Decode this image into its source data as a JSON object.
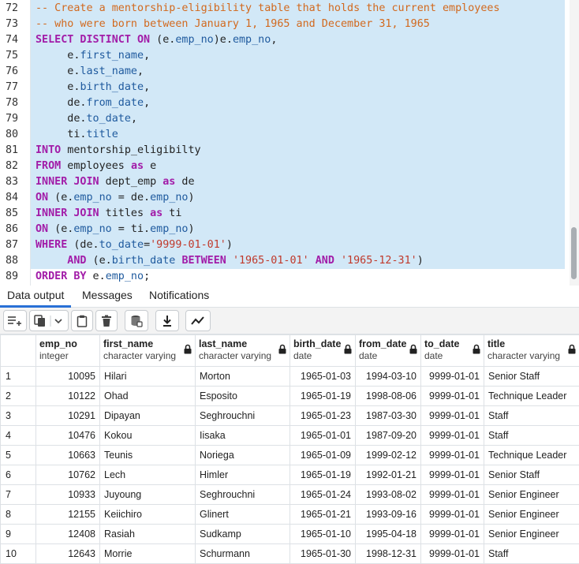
{
  "editor": {
    "line_numbers": [
      "72",
      "73",
      "74",
      "75",
      "76",
      "77",
      "78",
      "79",
      "80",
      "81",
      "82",
      "83",
      "84",
      "85",
      "86",
      "87",
      "88",
      "89"
    ],
    "lines": [
      [
        {
          "t": "-- Create a mentorship-eligibility table that holds the current employees",
          "c": "comment"
        }
      ],
      [
        {
          "t": "-- who were born between January 1, 1965 and December 31, 1965",
          "c": "comment"
        }
      ],
      [
        {
          "t": "SELECT DISTINCT ON",
          "c": "kw"
        },
        {
          "t": " (e.",
          "c": "plain"
        },
        {
          "t": "emp_no",
          "c": "id"
        },
        {
          "t": ")e.",
          "c": "plain"
        },
        {
          "t": "emp_no",
          "c": "id"
        },
        {
          "t": ",",
          "c": "plain"
        }
      ],
      [
        {
          "t": "     e.",
          "c": "plain"
        },
        {
          "t": "first_name",
          "c": "id"
        },
        {
          "t": ",",
          "c": "plain"
        }
      ],
      [
        {
          "t": "     e.",
          "c": "plain"
        },
        {
          "t": "last_name",
          "c": "id"
        },
        {
          "t": ",",
          "c": "plain"
        }
      ],
      [
        {
          "t": "     e.",
          "c": "plain"
        },
        {
          "t": "birth_date",
          "c": "id"
        },
        {
          "t": ",",
          "c": "plain"
        }
      ],
      [
        {
          "t": "     de.",
          "c": "plain"
        },
        {
          "t": "from_date",
          "c": "id"
        },
        {
          "t": ",",
          "c": "plain"
        }
      ],
      [
        {
          "t": "     de.",
          "c": "plain"
        },
        {
          "t": "to_date",
          "c": "id"
        },
        {
          "t": ",",
          "c": "plain"
        }
      ],
      [
        {
          "t": "     ti.",
          "c": "plain"
        },
        {
          "t": "title",
          "c": "id"
        }
      ],
      [
        {
          "t": "INTO",
          "c": "kw"
        },
        {
          "t": " mentorship_eligibilty",
          "c": "plain"
        }
      ],
      [
        {
          "t": "FROM",
          "c": "kw"
        },
        {
          "t": " employees ",
          "c": "plain"
        },
        {
          "t": "as",
          "c": "kw"
        },
        {
          "t": " e",
          "c": "plain"
        }
      ],
      [
        {
          "t": "INNER JOIN",
          "c": "kw"
        },
        {
          "t": " dept_emp ",
          "c": "plain"
        },
        {
          "t": "as",
          "c": "kw"
        },
        {
          "t": " de",
          "c": "plain"
        }
      ],
      [
        {
          "t": "ON",
          "c": "kw"
        },
        {
          "t": " (e.",
          "c": "plain"
        },
        {
          "t": "emp_no",
          "c": "id"
        },
        {
          "t": " = de.",
          "c": "plain"
        },
        {
          "t": "emp_no",
          "c": "id"
        },
        {
          "t": ")",
          "c": "plain"
        }
      ],
      [
        {
          "t": "INNER JOIN",
          "c": "kw"
        },
        {
          "t": " titles ",
          "c": "plain"
        },
        {
          "t": "as",
          "c": "kw"
        },
        {
          "t": " ti",
          "c": "plain"
        }
      ],
      [
        {
          "t": "ON",
          "c": "kw"
        },
        {
          "t": " (e.",
          "c": "plain"
        },
        {
          "t": "emp_no",
          "c": "id"
        },
        {
          "t": " = ti.",
          "c": "plain"
        },
        {
          "t": "emp_no",
          "c": "id"
        },
        {
          "t": ")",
          "c": "plain"
        }
      ],
      [
        {
          "t": "WHERE",
          "c": "kw"
        },
        {
          "t": " (de.",
          "c": "plain"
        },
        {
          "t": "to_date",
          "c": "id"
        },
        {
          "t": "=",
          "c": "plain"
        },
        {
          "t": "'9999-01-01'",
          "c": "str"
        },
        {
          "t": ")",
          "c": "plain"
        }
      ],
      [
        {
          "t": "     AND",
          "c": "kw"
        },
        {
          "t": " (e.",
          "c": "plain"
        },
        {
          "t": "birth_date",
          "c": "id"
        },
        {
          "t": " ",
          "c": "plain"
        },
        {
          "t": "BETWEEN",
          "c": "kw"
        },
        {
          "t": " ",
          "c": "plain"
        },
        {
          "t": "'1965-01-01'",
          "c": "str"
        },
        {
          "t": " ",
          "c": "plain"
        },
        {
          "t": "AND",
          "c": "kw"
        },
        {
          "t": " ",
          "c": "plain"
        },
        {
          "t": "'1965-12-31'",
          "c": "str"
        },
        {
          "t": ")",
          "c": "plain"
        }
      ],
      [
        {
          "t": "ORDER BY",
          "c": "kw"
        },
        {
          "t": " e.",
          "c": "plain"
        },
        {
          "t": "emp_no",
          "c": "id"
        },
        {
          "t": ";",
          "c": "plain"
        }
      ]
    ]
  },
  "tabs": [
    {
      "label": "Data output",
      "active": true
    },
    {
      "label": "Messages",
      "active": false
    },
    {
      "label": "Notifications",
      "active": false
    }
  ],
  "toolbar": {
    "buttons": [
      "add-row-icon",
      "copy-icon",
      "dropdown-icon",
      "paste-icon",
      "delete-icon",
      "save-data-icon",
      "download-icon",
      "graph-icon"
    ]
  },
  "grid": {
    "columns": [
      {
        "name": "emp_no",
        "type": "integer",
        "locked": false
      },
      {
        "name": "first_name",
        "type": "character varying",
        "locked": true
      },
      {
        "name": "last_name",
        "type": "character varying",
        "locked": true
      },
      {
        "name": "birth_date",
        "type": "date",
        "locked": true
      },
      {
        "name": "from_date",
        "type": "date",
        "locked": true
      },
      {
        "name": "to_date",
        "type": "date",
        "locked": true
      },
      {
        "name": "title",
        "type": "character varying",
        "locked": true
      }
    ],
    "rows": [
      [
        "1",
        "10095",
        "Hilari",
        "Morton",
        "1965-01-03",
        "1994-03-10",
        "9999-01-01",
        "Senior Staff"
      ],
      [
        "2",
        "10122",
        "Ohad",
        "Esposito",
        "1965-01-19",
        "1998-08-06",
        "9999-01-01",
        "Technique Leader"
      ],
      [
        "3",
        "10291",
        "Dipayan",
        "Seghrouchni",
        "1965-01-23",
        "1987-03-30",
        "9999-01-01",
        "Staff"
      ],
      [
        "4",
        "10476",
        "Kokou",
        "Iisaka",
        "1965-01-01",
        "1987-09-20",
        "9999-01-01",
        "Staff"
      ],
      [
        "5",
        "10663",
        "Teunis",
        "Noriega",
        "1965-01-09",
        "1999-02-12",
        "9999-01-01",
        "Technique Leader"
      ],
      [
        "6",
        "10762",
        "Lech",
        "Himler",
        "1965-01-19",
        "1992-01-21",
        "9999-01-01",
        "Senior Staff"
      ],
      [
        "7",
        "10933",
        "Juyoung",
        "Seghrouchni",
        "1965-01-24",
        "1993-08-02",
        "9999-01-01",
        "Senior Engineer"
      ],
      [
        "8",
        "12155",
        "Keiichiro",
        "Glinert",
        "1965-01-21",
        "1993-09-16",
        "9999-01-01",
        "Senior Engineer"
      ],
      [
        "9",
        "12408",
        "Rasiah",
        "Sudkamp",
        "1965-01-10",
        "1995-04-18",
        "9999-01-01",
        "Senior Engineer"
      ],
      [
        "10",
        "12643",
        "Morrie",
        "Schurmann",
        "1965-01-30",
        "1998-12-31",
        "9999-01-01",
        "Staff"
      ]
    ]
  },
  "colors": {
    "selection": "#d2e8f7",
    "keyword": "#a21ca8",
    "comment": "#d2691e",
    "identifier": "#1f5a9e",
    "string": "#c0392b",
    "active_tab": "#2970d6"
  }
}
